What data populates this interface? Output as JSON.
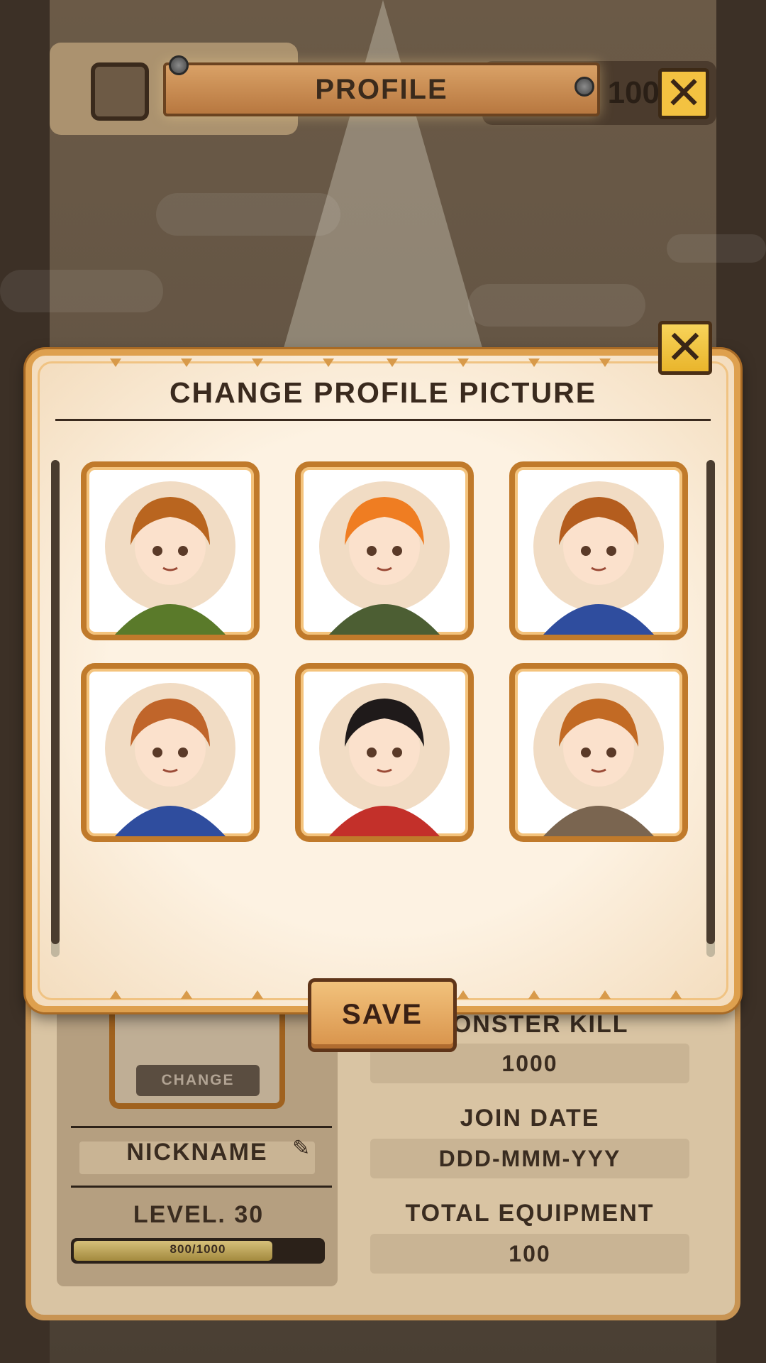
{
  "header": {
    "title": "PROFILE",
    "coins_partial": "100"
  },
  "profile": {
    "change_label": "CHANGE",
    "nickname": "NICKNAME",
    "level_label": "LEVEL. 30",
    "xp_text": "800/1000",
    "xp_fraction": 0.8,
    "stats": [
      {
        "label": "MONSTER KILL",
        "value": "1000"
      },
      {
        "label": "JOIN DATE",
        "value": "DDD-MMM-YYY"
      },
      {
        "label": "TOTAL EQUIPMENT",
        "value": "100"
      }
    ]
  },
  "modal": {
    "title": "CHANGE PROFILE PICTURE",
    "close_glyph": "✕",
    "save_label": "SAVE",
    "avatars": [
      {
        "hair": "#b9651f",
        "accent": "#5a7a2a"
      },
      {
        "hair": "#ef7d22",
        "accent": "#4c5e33"
      },
      {
        "hair": "#b45d1e",
        "accent": "#2f4d9e"
      },
      {
        "hair": "#c0652a",
        "accent": "#2f4d9e"
      },
      {
        "hair": "#1f1a1a",
        "accent": "#c3302a"
      },
      {
        "hair": "#c26a24",
        "accent": "#7a6550"
      }
    ]
  },
  "colors": {
    "frame": "#dea04e",
    "panel": "#fdf2e2",
    "accent": "#f3c241"
  }
}
